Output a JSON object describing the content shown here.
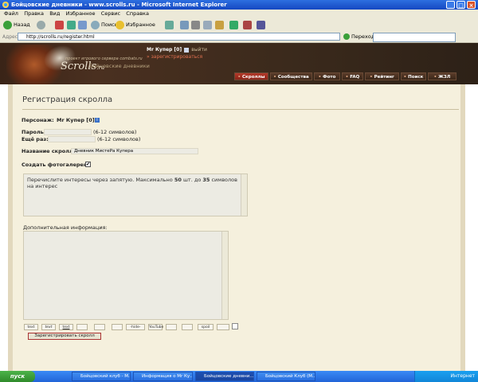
{
  "window": {
    "title": "Бойцовские дневники - www.scrolls.ru - Microsoft Internet Explorer",
    "min": "_",
    "max": "□",
    "close": "×"
  },
  "menu": [
    "Файл",
    "Правка",
    "Вид",
    "Избранное",
    "Сервис",
    "Справка"
  ],
  "toolbar": {
    "back_label": "Назад",
    "search_label": "Поиск",
    "favorites_label": "Избранное"
  },
  "address": {
    "label": "Адрес",
    "url": "http://scrolls.ru/register.html",
    "go_label": "Переход"
  },
  "site": {
    "logo": "Scrolls",
    "logo_suffix": ".ru",
    "tagline": "проект игрового сервера combats.ru",
    "logo_sub": "Бойцовские дневники",
    "user_name": "Mr Купер [0]",
    "logout": "выйти",
    "register_link": "» зарегистрироваться",
    "nav": [
      "Скроллы",
      "Сообщества",
      "Фото",
      "FAQ",
      "Рейтинг",
      "Поиск",
      "ЖЗЛ"
    ]
  },
  "form": {
    "title": "Регистрация скролла",
    "character_label": "Персонаж:",
    "character_value": "Mr Купер [0]",
    "password_label": "Пароль:",
    "password_hint": "(6-12 символов)",
    "repeat_label": "Ещё раз:",
    "repeat_hint": "(6-12 символов)",
    "scroll_name_label": "Название скролла:",
    "scroll_name_value": "Дневник МистеРа Купера",
    "gallery_label": "Создать фотогалерею:",
    "gallery_checked": "✔",
    "interests_text_a": "Перечислите интересы через запятую. Максимально ",
    "interests_max": "50",
    "interests_text_b": " шт. до ",
    "interests_chars": "35",
    "interests_text_c": " символов на интерес",
    "extra_label": "Дополнительная информация:",
    "format_buttons": [
      "text",
      "text",
      "text",
      "",
      "",
      "",
      "-hide-",
      "YouTube",
      "",
      "",
      "spoil",
      ""
    ],
    "submit_label": "Зарегистрировать скролл"
  },
  "statusbar": {
    "zone": "Интернет"
  },
  "taskbar": {
    "start": "пуск",
    "tasks": [
      "Бойцовский клуб - М...",
      "Информация о Mr Ку...",
      "Бойцовские дневни...",
      "Бойцовский Клуб (М..."
    ],
    "tray_text": ""
  },
  "colors": {
    "accent_nav_active": "#b53a2a",
    "parchment": "#f5f0dd",
    "header_brown": "#3a2417"
  }
}
